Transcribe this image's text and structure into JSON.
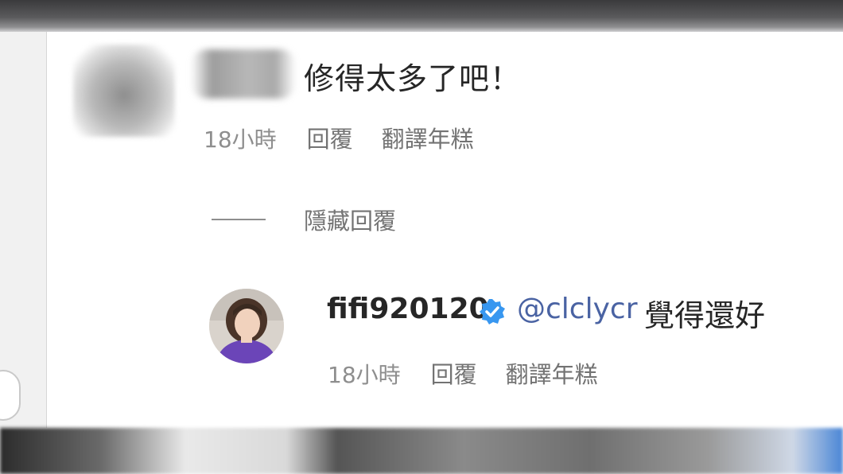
{
  "comment": {
    "text": "修得太多了吧！",
    "time": "18小時",
    "reply_label": "回覆",
    "translate_label": "翻譯年糕"
  },
  "hide_replies_label": "隱藏回覆",
  "reply": {
    "username": "fifi920120",
    "verified": true,
    "mention": "@clclycr",
    "text": "覺得還好",
    "time": "18小時",
    "reply_label": "回覆",
    "translate_label": "翻譯年糕"
  },
  "colors": {
    "text": "#262626",
    "meta": "#8e8e8e",
    "mention": "#4a63a3",
    "verified_badge": "#3897f0"
  }
}
